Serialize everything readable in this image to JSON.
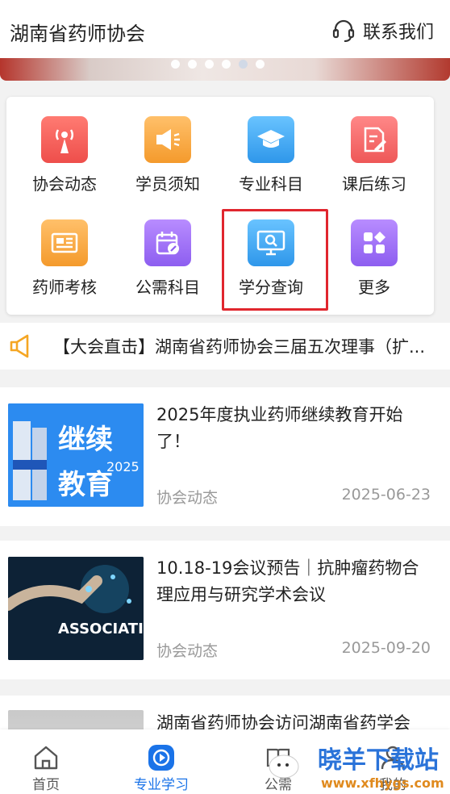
{
  "header": {
    "title": "湖南省药师协会",
    "contact_label": "联系我们",
    "contact_icon": "headset-icon"
  },
  "carousel": {
    "dots": 6,
    "active_index": 4
  },
  "grid": {
    "items": [
      {
        "id": "xiehui",
        "label": "协会动态",
        "icon": "broadcast-icon",
        "color": "#f25f5c"
      },
      {
        "id": "xueyuan",
        "label": "学员须知",
        "icon": "speaker-icon",
        "color": "#f9a03f"
      },
      {
        "id": "zhuanye",
        "label": "专业科目",
        "icon": "graduation-cap-icon",
        "color": "#33a3ef"
      },
      {
        "id": "kehou",
        "label": "课后练习",
        "icon": "edit-document-icon",
        "color": "#f46a6a"
      },
      {
        "id": "yaoshi",
        "label": "药师考核",
        "icon": "news-icon",
        "color": "#f9a03f"
      },
      {
        "id": "gongxu",
        "label": "公需科目",
        "icon": "calendar-edit-icon",
        "color": "#9b6ff0"
      },
      {
        "id": "xuefen",
        "label": "学分查询",
        "icon": "monitor-search-icon",
        "color": "#33a3ef"
      },
      {
        "id": "gengduo",
        "label": "更多",
        "icon": "apps-icon",
        "color": "#9b6ff0"
      }
    ]
  },
  "notice": {
    "icon": "megaphone-icon",
    "text": "【大会直击】湖南省药师协会三届五次理事（扩..."
  },
  "news": [
    {
      "title": "2025年度执业药师继续教育开始了！",
      "source": "协会动态",
      "date": "2025-06-23",
      "thumb_text_1": "继续",
      "thumb_text_2": "教育",
      "thumb_text_3": "2025"
    },
    {
      "title": "10.18-19会议预告｜抗肿瘤药物合理应用与研究学术会议",
      "source": "协会动态",
      "date": "2025-09-20",
      "thumb_text_1": "ASSOCIATION"
    },
    {
      "title": "湖南省药师协会访问湖南省药学会"
    }
  ],
  "tabbar": {
    "tabs": [
      {
        "label": "首页",
        "icon": "home-icon"
      },
      {
        "label": "专业学习",
        "icon": "play-circle-icon"
      },
      {
        "label": "公需",
        "icon": "book-icon"
      },
      {
        "label": "我的",
        "icon": "user-icon"
      }
    ]
  },
  "watermark": {
    "line1": "晓羊下载站",
    "line2": "www.xfhygs.com"
  }
}
